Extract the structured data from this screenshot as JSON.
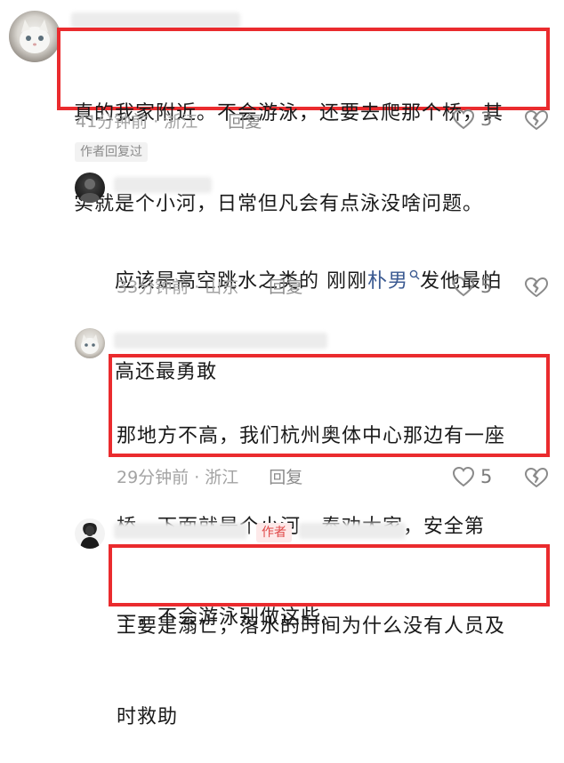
{
  "comments": [
    {
      "text": "真的我家附近。不会游泳，还要去爬那个桥，其实就是个小河，日常但凡会有点泳没啥问题。",
      "line1": "真的我家附近。不会游泳，还要去爬那个桥，其",
      "line2": "实就是个小河，日常但凡会有点泳没啥问题。",
      "time": "41分钟前",
      "location": "浙江",
      "reply_label": "回复",
      "likes": "3"
    },
    {
      "tag": "作者回复过"
    },
    {
      "line1_pre": "应该是高空跳水之类的 刚刚",
      "line1_link": "朴男",
      "line1_post": "发他最怕",
      "line2": "高还最勇敢",
      "time": "33分钟前",
      "location": "山东",
      "reply_label": "回复",
      "likes": "5"
    },
    {
      "line1": "那地方不高，我们杭州奥体中心那边有一座",
      "line2": "桥，下面就是个小河，奉劝大家，安全第",
      "line3": "一，不会游泳别做这些。",
      "time": "29分钟前",
      "location": "浙江",
      "reply_label": "回复",
      "likes": "5"
    },
    {
      "badge": "作者",
      "line1": "主要是溺亡，落水的时间为什么没有人员及",
      "line2": "时救助"
    }
  ],
  "colors": {
    "highlight": "#ea2b2e",
    "link": "#3b5a92",
    "meta": "#a3a3a3"
  }
}
